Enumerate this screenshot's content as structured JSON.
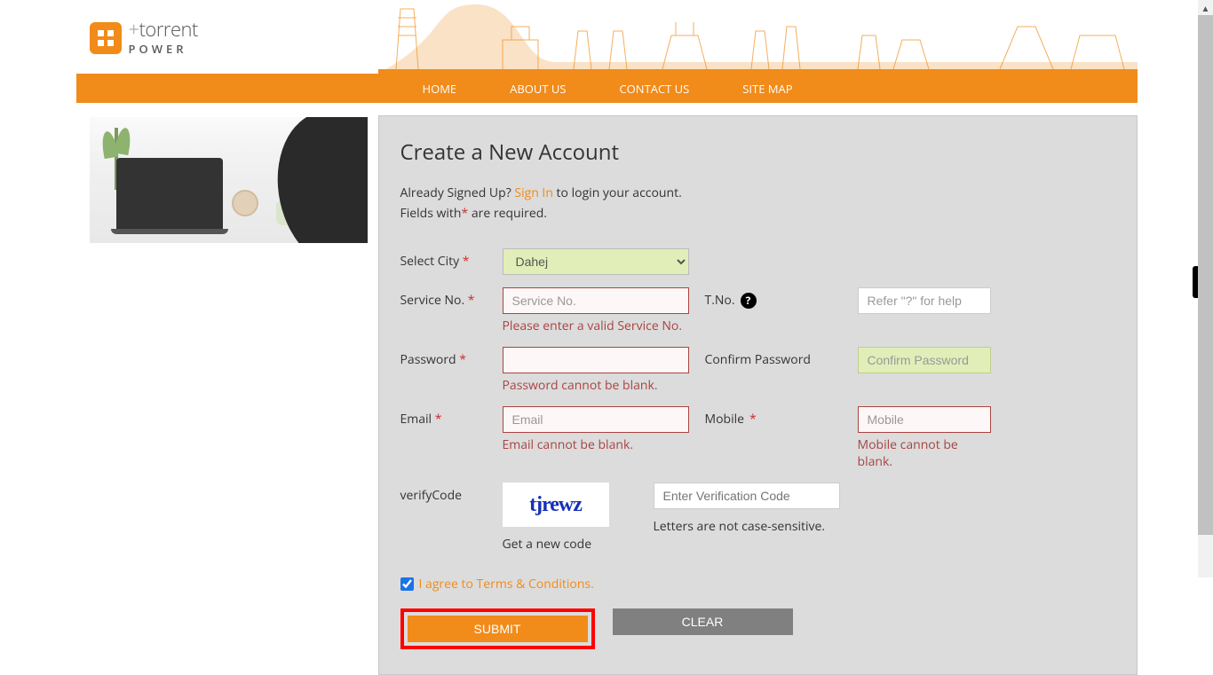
{
  "brand": {
    "name": "torrent",
    "line2": "POWER"
  },
  "nav": {
    "home": "HOME",
    "about": "ABOUT US",
    "contact": "CONTACT US",
    "sitemap": "SITE MAP"
  },
  "page": {
    "title": "Create a New Account",
    "already_signed": "Already Signed Up? ",
    "sign_in": "Sign In",
    "login_suffix": " to login your account.",
    "fields_with": "Fields with",
    "required_suffix": " are required."
  },
  "form": {
    "select_city_label": "Select City ",
    "city_selected": "Dahej",
    "service_no_label": "Service No. ",
    "service_no_placeholder": "Service No.",
    "service_no_error": "Please enter a valid Service No.",
    "tno_label": "T.No. ",
    "tno_placeholder": "Refer \"?\" for help",
    "password_label": "Password ",
    "password_error": "Password cannot be blank.",
    "confirm_password_label": "Confirm Password",
    "confirm_password_placeholder": "Confirm Password",
    "email_label": "Email ",
    "email_placeholder": "Email",
    "email_error": "Email cannot be blank.",
    "mobile_label": "Mobile ",
    "mobile_placeholder": "Mobile",
    "mobile_error": "Mobile cannot be blank.",
    "verify_label": "verifyCode",
    "captcha_text": "tjrewz",
    "verification_placeholder": "Enter Verification Code",
    "case_note": "Letters are not case-sensitive.",
    "new_code": "Get a new code",
    "terms": "I agree to Terms & Conditions.",
    "submit": "SUBMIT",
    "clear": "CLEAR"
  }
}
